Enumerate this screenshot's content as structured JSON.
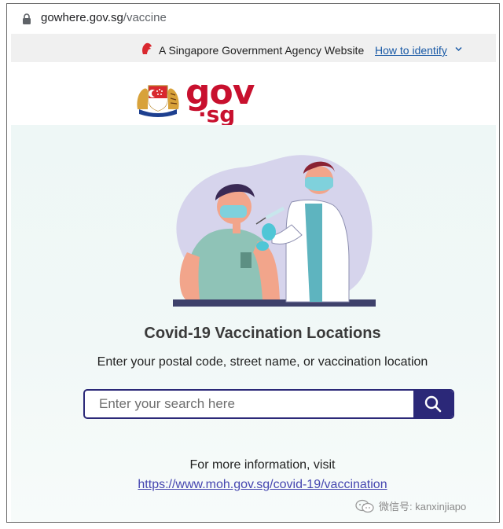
{
  "browser": {
    "url_host": "gowhere.gov.sg",
    "url_path": "/vaccine"
  },
  "gov_banner": {
    "text": "A Singapore Government Agency Website",
    "identify_link": "How to identify"
  },
  "logo": {
    "gov": "gov",
    "sg": "·sg"
  },
  "hero": {
    "title": "Covid-19 Vaccination Locations",
    "subtitle": "Enter your postal code, street name, or vaccination location"
  },
  "search": {
    "placeholder": "Enter your search here",
    "value": ""
  },
  "footer_info": {
    "prefix": "For more information, visit",
    "link": "https://www.moh.gov.sg/covid-19/vaccination"
  },
  "watermark": {
    "text": "微信号: kanxinjiapo"
  },
  "colors": {
    "brand_red": "#c8102e",
    "search_navy": "#2b2878",
    "link_blue": "#4646b0",
    "hero_bg": "#eef7f6"
  },
  "icons": [
    "lock-icon",
    "lion-head-icon",
    "chevron-down-icon",
    "singapore-crest-icon",
    "vaccination-illustration",
    "search-icon",
    "wechat-icon"
  ]
}
